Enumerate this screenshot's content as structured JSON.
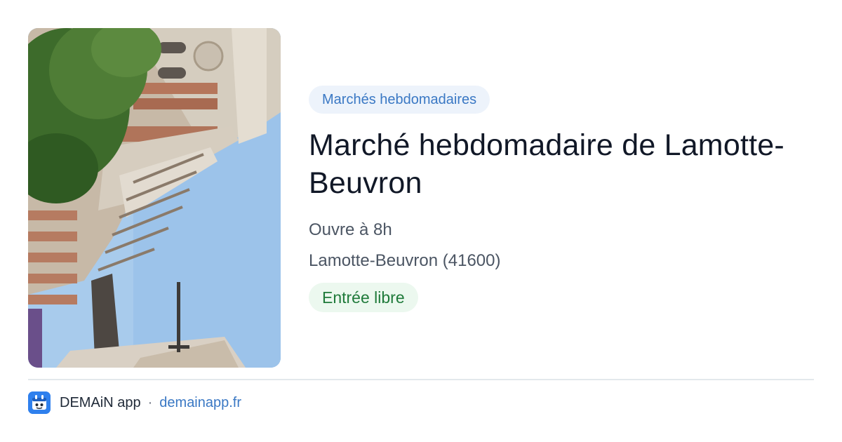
{
  "card": {
    "category": "Marchés hebdomadaires",
    "title": "Marché hebdomadaire de Lamotte-Beuvron",
    "hours": "Ouvre à 8h",
    "location": "Lamotte-Beuvron (41600)",
    "access": "Entrée libre"
  },
  "footer": {
    "app_name": "DEMAiN app",
    "separator": "·",
    "domain": "demainapp.fr"
  },
  "colors": {
    "category_bg": "#edf3fb",
    "category_text": "#3a78c4",
    "title_text": "#111827",
    "access_bg": "#ecf8ef",
    "access_text": "#1f7a3a",
    "app_icon": "#2f80ed"
  },
  "icons": {
    "app_icon": "calendar-mascot-icon"
  }
}
